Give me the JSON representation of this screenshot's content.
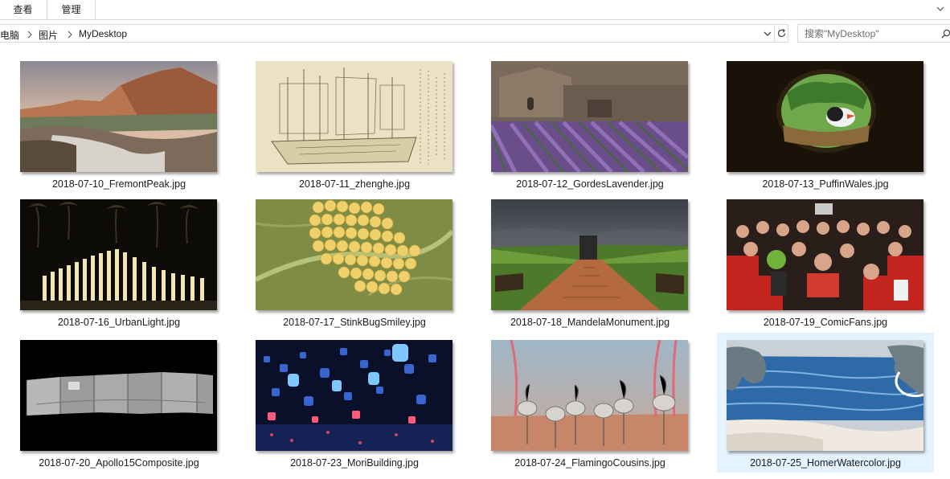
{
  "ribbon": {
    "tabs": [
      {
        "label": "查看"
      },
      {
        "label": "管理"
      }
    ],
    "expand_icon": "chevron-down-icon"
  },
  "address_bar": {
    "breadcrumb": [
      {
        "label": "电脑"
      },
      {
        "label": "图片"
      },
      {
        "label": "MyDesktop"
      }
    ],
    "separator_icon": "chevron-right-icon",
    "dropdown_icon": "chevron-down-icon",
    "refresh_icon": "refresh-icon"
  },
  "search": {
    "placeholder": "搜索\"MyDesktop\"",
    "value": "",
    "icon": "search-icon"
  },
  "files": [
    {
      "name": "2018-07-10_FremontPeak.jpg",
      "thumb": "fremont"
    },
    {
      "name": "2018-07-11_zhenghe.jpg",
      "thumb": "zhenghe"
    },
    {
      "name": "2018-07-12_GordesLavender.jpg",
      "thumb": "lavender"
    },
    {
      "name": "2018-07-13_PuffinWales.jpg",
      "thumb": "puffin"
    },
    {
      "name": "2018-07-16_UrbanLight.jpg",
      "thumb": "urbanlight"
    },
    {
      "name": "2018-07-17_StinkBugSmiley.jpg",
      "thumb": "stinkbug"
    },
    {
      "name": "2018-07-18_MandelaMonument.jpg",
      "thumb": "mandela"
    },
    {
      "name": "2018-07-19_ComicFans.jpg",
      "thumb": "comicfans"
    },
    {
      "name": "2018-07-20_Apollo15Composite.jpg",
      "thumb": "apollo"
    },
    {
      "name": "2018-07-23_MoriBuilding.jpg",
      "thumb": "mori"
    },
    {
      "name": "2018-07-24_FlamingoCousins.jpg",
      "thumb": "flamingo"
    },
    {
      "name": "2018-07-25_HomerWatercolor.jpg",
      "thumb": "homer",
      "state": "hovered"
    }
  ]
}
